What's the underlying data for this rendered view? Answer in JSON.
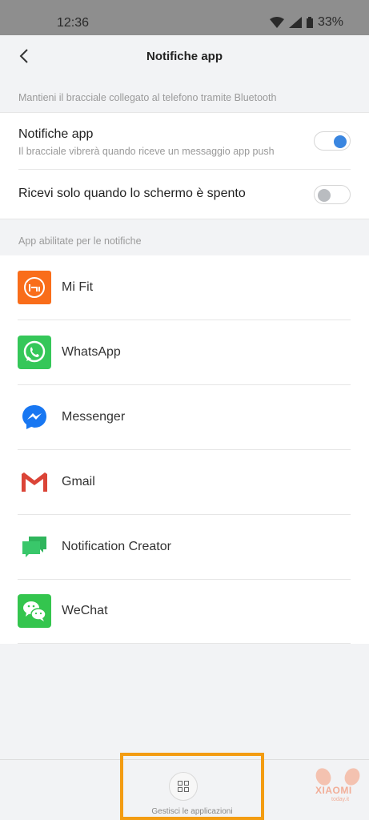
{
  "status_bar": {
    "time": "12:36",
    "battery": "33%"
  },
  "header": {
    "title": "Notifiche app"
  },
  "section1": {
    "label": "Mantieni il bracciale collegato al telefono tramite Bluetooth"
  },
  "settings": [
    {
      "title": "Notifiche app",
      "subtitle": "Il bracciale vibrerà quando riceve un messaggio app push",
      "enabled": true
    },
    {
      "title": "Ricevi solo quando lo schermo è spento",
      "enabled": false
    }
  ],
  "section2": {
    "label": "App abilitate per le notifiche"
  },
  "apps": [
    {
      "name": "Mi Fit",
      "icon": "mi-fit-icon",
      "color": "#f96d1a"
    },
    {
      "name": "WhatsApp",
      "icon": "whatsapp-icon",
      "color": "#35c759"
    },
    {
      "name": "Messenger",
      "icon": "messenger-icon",
      "color": "#1877f2"
    },
    {
      "name": "Gmail",
      "icon": "gmail-icon",
      "color": "#db4437"
    },
    {
      "name": "Notification Creator",
      "icon": "chat-bubbles-icon",
      "color": "#2fb55c"
    },
    {
      "name": "WeChat",
      "icon": "wechat-icon",
      "color": "#34c54e"
    }
  ],
  "bottom": {
    "manage_label": "Gestisci le applicazioni"
  },
  "watermark": {
    "brand": "XIAOMI",
    "sub": "today.it"
  },
  "colors": {
    "accent": "#3a86e0",
    "highlight": "#f39c12"
  }
}
